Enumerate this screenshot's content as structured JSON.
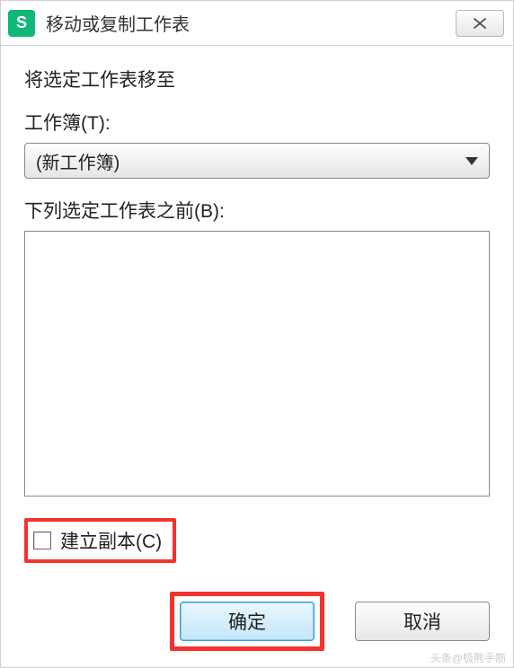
{
  "titlebar": {
    "app_icon_letter": "S",
    "title": "移动或复制工作表"
  },
  "body": {
    "move_to_label": "将选定工作表移至",
    "workbook_label": "工作簿(T):",
    "workbook_value": "(新工作簿)",
    "before_sheet_label": "下列选定工作表之前(B):",
    "sheet_list": [],
    "create_copy_label": "建立副本(C)",
    "create_copy_checked": false
  },
  "buttons": {
    "ok": "确定",
    "cancel": "取消"
  },
  "watermark": "头条@极熊手筋"
}
